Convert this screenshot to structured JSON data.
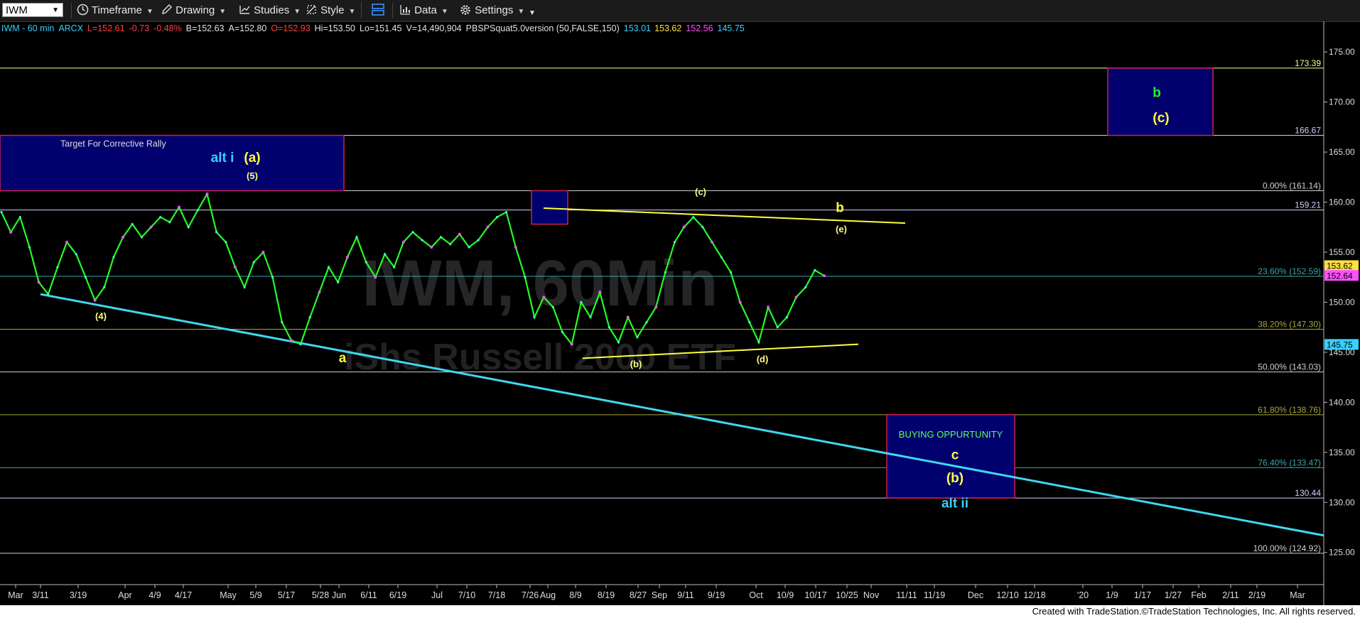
{
  "toolbar": {
    "symbol": "IWM",
    "items": [
      {
        "label": "Timeframe",
        "icon": "clock-icon"
      },
      {
        "label": "Drawing",
        "icon": "pencil-icon"
      },
      {
        "label": "Studies",
        "icon": "studies-icon"
      },
      {
        "label": "Style",
        "icon": "style-icon"
      },
      {
        "label": "Data",
        "icon": "data-icon"
      },
      {
        "label": "Settings",
        "icon": "gear-icon"
      }
    ]
  },
  "header": {
    "segments": [
      {
        "text": "IWM - 60 min",
        "color": "#36d0ff"
      },
      {
        "text": "ARCX",
        "color": "#36d0ff"
      },
      {
        "text": "L=152.61",
        "color": "#ff4040"
      },
      {
        "text": "-0.73",
        "color": "#ff4040"
      },
      {
        "text": "-0.48%",
        "color": "#ff4040"
      },
      {
        "text": "B=152.63",
        "color": "#e0e0e0"
      },
      {
        "text": "A=152.80",
        "color": "#e0e0e0"
      },
      {
        "text": "O=152.93",
        "color": "#ff4040"
      },
      {
        "text": "Hi=153.50",
        "color": "#e0e0e0"
      },
      {
        "text": "Lo=151.45",
        "color": "#e0e0e0"
      },
      {
        "text": "V=14,490,904",
        "color": "#e0e0e0"
      },
      {
        "text": "PBSPSquat5.0version (50,FALSE,150)",
        "color": "#e0e0e0"
      },
      {
        "text": "153.01",
        "color": "#36d0ff"
      },
      {
        "text": "153.62",
        "color": "#ffe040"
      },
      {
        "text": "152.56",
        "color": "#ff50ff"
      },
      {
        "text": "145.75",
        "color": "#36d0ff"
      }
    ]
  },
  "chart_data": {
    "type": "line",
    "symbol": "IWM",
    "timeframe": "60 min",
    "watermark": {
      "primary": "IWM, 60Min",
      "secondary": "iShs Russell 2000 ETF"
    },
    "ylim": [
      122,
      177
    ],
    "y_ticks": [
      125,
      130,
      135,
      140,
      145,
      150,
      155,
      160,
      165,
      170,
      175
    ],
    "x_tick_labels": [
      "Mar",
      "3/11",
      "3/19",
      "Apr",
      "4/9",
      "4/17",
      "May",
      "5/9",
      "5/17",
      "5/28",
      "Jun",
      "6/11",
      "6/19",
      "Jul",
      "7/10",
      "7/18",
      "7/26",
      "Aug",
      "8/9",
      "8/19",
      "8/27",
      "Sep",
      "9/11",
      "9/19",
      "Oct",
      "10/9",
      "10/17",
      "10/25",
      "Nov",
      "11/11",
      "11/19",
      "Dec",
      "12/10",
      "12/18",
      "'20",
      "1/9",
      "1/17",
      "1/27",
      "Feb",
      "2/11",
      "2/19",
      "Mar"
    ],
    "last_price": 152.64,
    "price_tags": [
      {
        "value": 153.62,
        "text": "153.62",
        "color": "#ffe040"
      },
      {
        "value": 152.64,
        "text": "152.64",
        "color": "#ff50ff"
      },
      {
        "value": 145.75,
        "text": "145.75",
        "color": "#36d0ff"
      }
    ],
    "series": [
      {
        "values": [
          159.0,
          157.0,
          158.5,
          155.5,
          152.0,
          150.8,
          153.5,
          156.0,
          154.8,
          152.5,
          150.2,
          151.5,
          154.5,
          156.5,
          157.8,
          156.5,
          157.5,
          158.5,
          158.0,
          159.5,
          157.5,
          159.2,
          160.8,
          157.0,
          156.0,
          153.5,
          151.5,
          154.0,
          155.0,
          152.5,
          148.0,
          146.2,
          145.8,
          148.5,
          151.0,
          153.5,
          152.0,
          154.5,
          156.5,
          154.0,
          152.5,
          154.8,
          153.5,
          156.0,
          157.0,
          156.2,
          155.5,
          156.5,
          155.8,
          156.8,
          155.5,
          156.2,
          157.5,
          158.5,
          159.0,
          155.5,
          152.5,
          148.5,
          150.5,
          149.5,
          147.0,
          145.8,
          150.0,
          148.5,
          151.0,
          147.5,
          146.0,
          148.5,
          146.5,
          148.0,
          149.5,
          153.0,
          156.0,
          157.5,
          158.5,
          157.5,
          156.0,
          154.5,
          153.0,
          150.0,
          148.0,
          146.0,
          149.5,
          147.5,
          148.5,
          150.5,
          151.5,
          153.2,
          152.64
        ],
        "color": "#22ff22"
      }
    ],
    "horizontal_lines": [
      {
        "value": 173.39,
        "text": "173.39",
        "color": "#ffff88"
      },
      {
        "value": 166.67,
        "text": "166.67",
        "color": "#d0d0ff"
      },
      {
        "value": 161.14,
        "text": "0.00% (161.14)",
        "color": "#d0d0d0"
      },
      {
        "value": 159.21,
        "text": "159.21",
        "color": "#d0d0ff"
      },
      {
        "value": 152.59,
        "text": "23.60% (152.59)",
        "color": "#39a8a8"
      },
      {
        "value": 147.3,
        "text": "38.20% (147.30)",
        "color": "#a8a840"
      },
      {
        "value": 143.03,
        "text": "50.00% (143.03)",
        "color": "#d0d0d0"
      },
      {
        "value": 138.76,
        "text": "61.80% (138.76)",
        "color": "#a8a840"
      },
      {
        "value": 133.47,
        "text": "76.40% (133.47)",
        "color": "#39a8a8"
      },
      {
        "value": 130.44,
        "text": "130.44",
        "color": "#d0d0ff"
      },
      {
        "value": 124.92,
        "text": "100.00% (124.92)",
        "color": "#d0d0d0"
      }
    ],
    "trendlines": [
      {
        "from": {
          "x": "3/11",
          "y": 150.8
        },
        "to": {
          "x": "Mar",
          "y": 126.7
        },
        "color": "#40d8f0"
      },
      {
        "from": {
          "x": "7/26",
          "y": 159.4
        },
        "to": {
          "x": "11/11",
          "y": 157.9
        },
        "color": "#ffff40"
      },
      {
        "from": {
          "x": "8/9",
          "y": 144.4
        },
        "to": {
          "x": "10/25",
          "y": 145.8
        },
        "color": "#ffff40"
      }
    ],
    "boxes": [
      {
        "from": {
          "x": "Mar",
          "y": 166.67
        },
        "to": {
          "x": "5/28",
          "y": 161.14
        },
        "text": "Target For Corrective Rally",
        "color": "#00006e"
      },
      {
        "from": {
          "x": "7/26",
          "y": 161.14
        },
        "to": {
          "x": "Aug",
          "y": 157.8
        },
        "text": "(a)",
        "color": "#00006e"
      },
      {
        "from": {
          "x": "1/9",
          "y": 173.39
        },
        "to": {
          "x": "Feb",
          "y": 166.67
        },
        "text": "",
        "color": "#00006e"
      },
      {
        "from": {
          "x": "Dec",
          "y": 138.76
        },
        "to": {
          "x": "12/18",
          "y": 130.44
        },
        "text": "BUYING OPPURTUNITY",
        "color": "#00006e"
      }
    ],
    "annotations": [
      {
        "text": "alt i",
        "x": "3/19",
        "y": 164.0,
        "color": "#36d0ff"
      },
      {
        "text": "(a)",
        "x": "May",
        "y": 164.0,
        "color": "#ffff40"
      },
      {
        "text": "(5)",
        "x": "May",
        "y": 162.3,
        "color": "#ffff80"
      },
      {
        "text": "(4)",
        "x": "3/19",
        "y": 148.3,
        "color": "#ffff80"
      },
      {
        "text": "a",
        "x": "Jun",
        "y": 144.0,
        "color": "#ffff40"
      },
      {
        "text": "(b)",
        "x": "8/27",
        "y": 143.5,
        "color": "#ffff80"
      },
      {
        "text": "(c)",
        "x": "9/11",
        "y": 160.7,
        "color": "#ffff80"
      },
      {
        "text": "(d)",
        "x": "Oct",
        "y": 144.0,
        "color": "#ffff80"
      },
      {
        "text": "b",
        "x": "10/17",
        "y": 159.0,
        "color": "#ffff40"
      },
      {
        "text": "(e)",
        "x": "10/17",
        "y": 157.0,
        "color": "#ffff80"
      },
      {
        "text": "b",
        "x": "1/17",
        "y": 170.5,
        "color": "#22ff22"
      },
      {
        "text": "(c)",
        "x": "1/17",
        "y": 168.0,
        "color": "#ffff40"
      },
      {
        "text": "c",
        "x": "Dec",
        "y": 134.3,
        "color": "#ffff40"
      },
      {
        "text": "(b)",
        "x": "Dec",
        "y": 132.0,
        "color": "#ffff40"
      },
      {
        "text": "alt ii",
        "x": "Dec",
        "y": 129.5,
        "color": "#36d0ff"
      }
    ],
    "grid": false
  },
  "footer": {
    "text": "Created with TradeStation.©TradeStation Technologies, Inc. All rights reserved."
  }
}
